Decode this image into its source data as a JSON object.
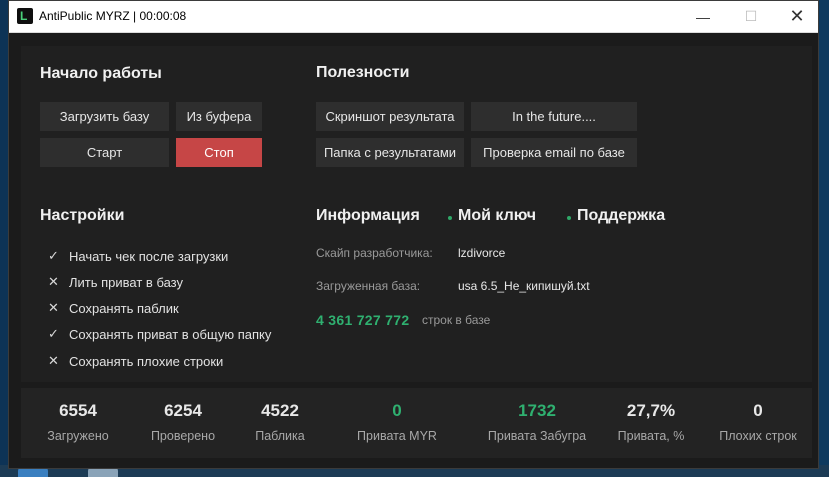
{
  "window": {
    "title": "AntiPublic MYRZ | 00:00:08",
    "icon_letter": "L",
    "controls": {
      "minimize": "—",
      "maximize": "☐",
      "close": "✕"
    }
  },
  "start": {
    "title": "Начало работы",
    "load_db": "Загрузить базу",
    "from_clipboard": "Из буфера",
    "start": "Старт",
    "stop": "Стоп"
  },
  "tools": {
    "title": "Полезности",
    "screenshot": "Скриншот результата",
    "future": "In the future....",
    "results_folder": "Папка с результатами",
    "check_email": "Проверка email по базе"
  },
  "settings": {
    "title": "Настройки",
    "items": [
      {
        "label": "Начать чек после загрузки",
        "checked": true,
        "mark": "✓"
      },
      {
        "label": "Лить приват в базу",
        "checked": false,
        "mark": "✕"
      },
      {
        "label": "Сохранять паблик",
        "checked": false,
        "mark": "✕"
      },
      {
        "label": "Сохранять приват в общую папку",
        "checked": true,
        "mark": "✓"
      },
      {
        "label": "Сохранять плохие строки",
        "checked": false,
        "mark": "✕"
      }
    ]
  },
  "info": {
    "tabs": [
      "Информация",
      "Мой ключ",
      "Поддержка"
    ],
    "skype_label": "Скайп разработчика:",
    "skype_value": "lzdivorce",
    "db_label": "Загруженная база:",
    "db_value": "usa 6.5_Не_кипишуй.txt",
    "line_count": "4 361 727 772",
    "line_count_suffix": "строк в базе"
  },
  "stats": [
    {
      "value": "6554",
      "label": "Загружено"
    },
    {
      "value": "6254",
      "label": "Проверено"
    },
    {
      "value": "4522",
      "label": "Паблика"
    },
    {
      "value": "0",
      "label": "Привата MYR",
      "accent": true
    },
    {
      "value": "1732",
      "label": "Привата Забугра",
      "accent": true
    },
    {
      "value": "27,7%",
      "label": "Привата, %"
    },
    {
      "value": "0",
      "label": "Плохих строк"
    }
  ],
  "colors": {
    "accent_green": "#2fb070",
    "stop_red": "#c64646",
    "bg": "#1b1b1b"
  }
}
